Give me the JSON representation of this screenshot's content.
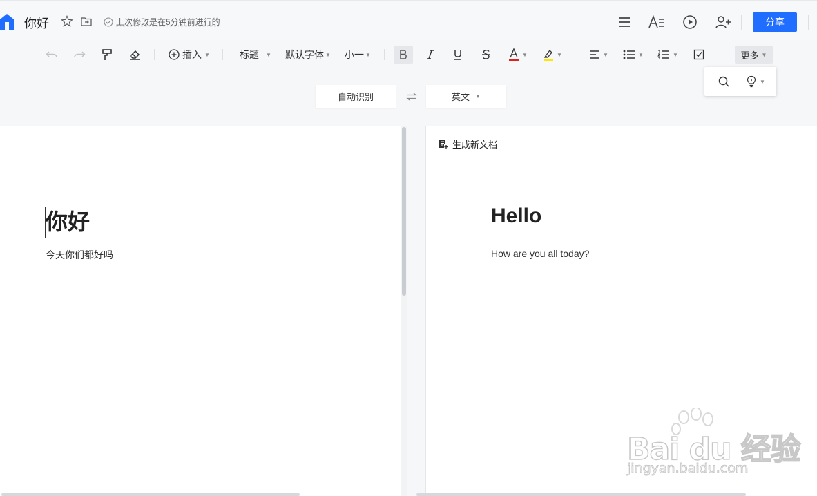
{
  "header": {
    "title": "你好",
    "save_status": "上次修改是在5分钟前进行的",
    "share_label": "分享"
  },
  "toolbar": {
    "insert_label": "插入",
    "heading_label": "标题",
    "font_label": "默认字体",
    "size_label": "小一",
    "more_label": "更多",
    "font_color": "#e02020",
    "highlight_color": "#ffe600"
  },
  "translate": {
    "source_lang": "自动识别",
    "target_lang": "英文"
  },
  "left_doc": {
    "heading": "你好",
    "paragraph": "今天你们都好吗"
  },
  "right_doc": {
    "generate_label": "生成新文档",
    "heading": "Hello",
    "paragraph": "How are you all today?"
  },
  "watermark": {
    "brand": "Bai du 经验",
    "url": "jingyan.baidu.com"
  },
  "colors": {
    "accent": "#1f6eff"
  }
}
